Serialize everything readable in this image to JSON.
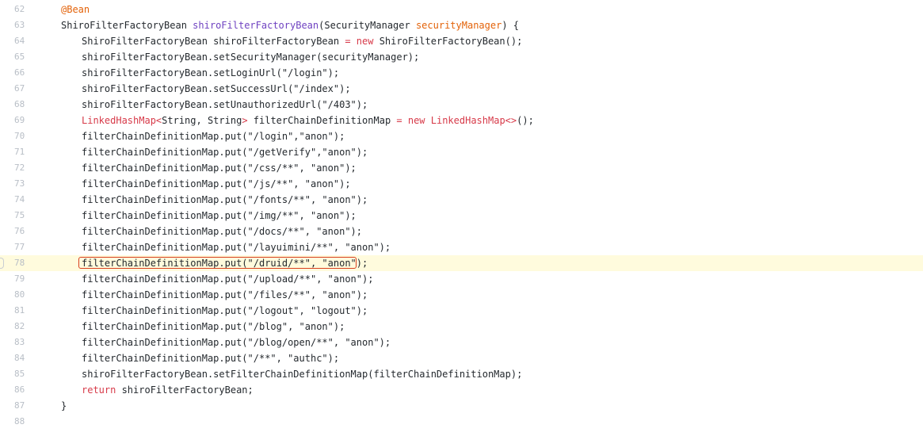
{
  "editor": {
    "highlighted_line": "78",
    "colors": {
      "highlight_background": "#fffbdd",
      "selection_border": "#d9401e",
      "keyword": "#d73a49",
      "method_name": "#6f42c1",
      "parameter": "#e36209"
    },
    "lines": [
      {
        "number": "62",
        "indent": 1,
        "tokens": [
          {
            "t": "@Bean",
            "c": "annotation"
          }
        ]
      },
      {
        "number": "63",
        "indent": 1,
        "tokens": [
          {
            "t": "ShiroFilterFactoryBean ",
            "c": "plain"
          },
          {
            "t": "shiroFilterFactoryBean",
            "c": "method"
          },
          {
            "t": "(SecurityManager ",
            "c": "plain"
          },
          {
            "t": "securityManager",
            "c": "param"
          },
          {
            "t": ") {",
            "c": "plain"
          }
        ]
      },
      {
        "number": "64",
        "indent": 2,
        "tokens": [
          {
            "t": "ShiroFilterFactoryBean shiroFilterFactoryBean ",
            "c": "plain"
          },
          {
            "t": "= new",
            "c": "keyword"
          },
          {
            "t": " ShiroFilterFactoryBean();",
            "c": "plain"
          }
        ]
      },
      {
        "number": "65",
        "indent": 2,
        "tokens": [
          {
            "t": "shiroFilterFactoryBean.setSecurityManager(securityManager);",
            "c": "plain"
          }
        ]
      },
      {
        "number": "66",
        "indent": 2,
        "tokens": [
          {
            "t": "shiroFilterFactoryBean.setLoginUrl(\"/login\");",
            "c": "plain"
          }
        ]
      },
      {
        "number": "67",
        "indent": 2,
        "tokens": [
          {
            "t": "shiroFilterFactoryBean.setSuccessUrl(\"/index\");",
            "c": "plain"
          }
        ]
      },
      {
        "number": "68",
        "indent": 2,
        "tokens": [
          {
            "t": "shiroFilterFactoryBean.setUnauthorizedUrl(\"/403\");",
            "c": "plain"
          }
        ]
      },
      {
        "number": "69",
        "indent": 2,
        "tokens": [
          {
            "t": "LinkedHashMap<",
            "c": "keyword"
          },
          {
            "t": "String, String",
            "c": "plain"
          },
          {
            "t": ">",
            "c": "keyword"
          },
          {
            "t": " filterChainDefinitionMap ",
            "c": "plain"
          },
          {
            "t": "= new",
            "c": "keyword"
          },
          {
            "t": " ",
            "c": "plain"
          },
          {
            "t": "LinkedHashMap<>",
            "c": "keyword"
          },
          {
            "t": "();",
            "c": "plain"
          }
        ]
      },
      {
        "number": "70",
        "indent": 2,
        "tokens": [
          {
            "t": "filterChainDefinitionMap.put(\"/login\",\"anon\");",
            "c": "plain"
          }
        ]
      },
      {
        "number": "71",
        "indent": 2,
        "tokens": [
          {
            "t": "filterChainDefinitionMap.put(\"/getVerify\",\"anon\");",
            "c": "plain"
          }
        ]
      },
      {
        "number": "72",
        "indent": 2,
        "tokens": [
          {
            "t": "filterChainDefinitionMap.put(\"/css/**\", \"anon\");",
            "c": "plain"
          }
        ]
      },
      {
        "number": "73",
        "indent": 2,
        "tokens": [
          {
            "t": "filterChainDefinitionMap.put(\"/js/**\", \"anon\");",
            "c": "plain"
          }
        ]
      },
      {
        "number": "74",
        "indent": 2,
        "tokens": [
          {
            "t": "filterChainDefinitionMap.put(\"/fonts/**\", \"anon\");",
            "c": "plain"
          }
        ]
      },
      {
        "number": "75",
        "indent": 2,
        "tokens": [
          {
            "t": "filterChainDefinitionMap.put(\"/img/**\", \"anon\");",
            "c": "plain"
          }
        ]
      },
      {
        "number": "76",
        "indent": 2,
        "tokens": [
          {
            "t": "filterChainDefinitionMap.put(\"/docs/**\", \"anon\");",
            "c": "plain"
          }
        ]
      },
      {
        "number": "77",
        "indent": 2,
        "tokens": [
          {
            "t": "filterChainDefinitionMap.put(\"/layuimini/**\", \"anon\");",
            "c": "plain"
          }
        ]
      },
      {
        "number": "78",
        "indent": 2,
        "tokens": [
          {
            "t": "filterChainDefinitionMap.put(\"/druid/**\", \"anon\");",
            "c": "plain"
          }
        ]
      },
      {
        "number": "79",
        "indent": 2,
        "tokens": [
          {
            "t": "filterChainDefinitionMap.put(\"/upload/**\", \"anon\");",
            "c": "plain"
          }
        ]
      },
      {
        "number": "80",
        "indent": 2,
        "tokens": [
          {
            "t": "filterChainDefinitionMap.put(\"/files/**\", \"anon\");",
            "c": "plain"
          }
        ]
      },
      {
        "number": "81",
        "indent": 2,
        "tokens": [
          {
            "t": "filterChainDefinitionMap.put(\"/logout\", \"logout\");",
            "c": "plain"
          }
        ]
      },
      {
        "number": "82",
        "indent": 2,
        "tokens": [
          {
            "t": "filterChainDefinitionMap.put(\"/blog\", \"anon\");",
            "c": "plain"
          }
        ]
      },
      {
        "number": "83",
        "indent": 2,
        "tokens": [
          {
            "t": "filterChainDefinitionMap.put(\"/blog/open/**\", \"anon\");",
            "c": "plain"
          }
        ]
      },
      {
        "number": "84",
        "indent": 2,
        "tokens": [
          {
            "t": "filterChainDefinitionMap.put(\"/**\", \"authc\");",
            "c": "plain"
          }
        ]
      },
      {
        "number": "85",
        "indent": 2,
        "tokens": [
          {
            "t": "shiroFilterFactoryBean.setFilterChainDefinitionMap(filterChainDefinitionMap);",
            "c": "plain"
          }
        ]
      },
      {
        "number": "86",
        "indent": 2,
        "tokens": [
          {
            "t": "return",
            "c": "keyword"
          },
          {
            "t": " shiroFilterFactoryBean;",
            "c": "plain"
          }
        ]
      },
      {
        "number": "87",
        "indent": 1,
        "tokens": [
          {
            "t": "}",
            "c": "plain"
          }
        ]
      },
      {
        "number": "88",
        "indent": 0,
        "tokens": []
      }
    ]
  }
}
